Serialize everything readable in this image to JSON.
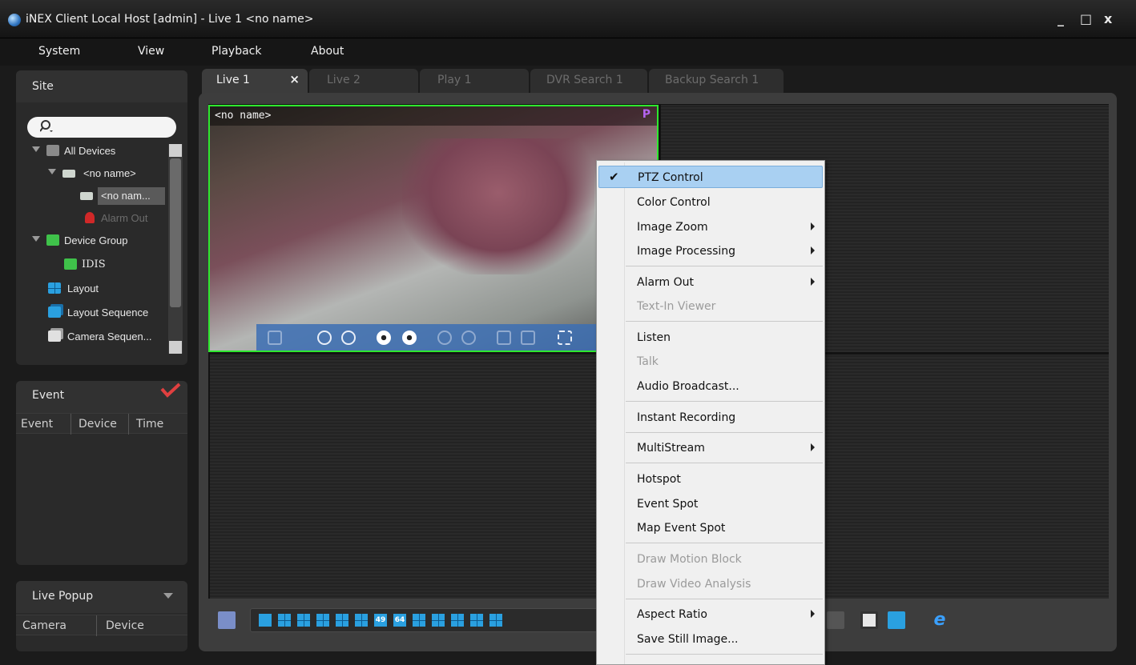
{
  "window": {
    "title": "iNEX Client Local Host [admin] - Live 1  <no name>",
    "controls": [
      "_",
      "□",
      "x"
    ]
  },
  "menubar": [
    "System",
    "View",
    "Playback",
    "About"
  ],
  "site_panel": {
    "title": "Site",
    "tree": [
      {
        "label": "All Devices",
        "icon": "devices-icon"
      },
      {
        "label": "<no name>",
        "icon": "dvr-icon"
      },
      {
        "label": "<no nam...",
        "icon": "camera-icon"
      },
      {
        "label": "Alarm Out",
        "icon": "alarm-icon"
      },
      {
        "label": "Device Group",
        "icon": "group-icon"
      },
      {
        "label": "IDIS",
        "icon": "group-item-icon"
      },
      {
        "label": "Layout",
        "icon": "layout-icon"
      },
      {
        "label": "Layout Sequence",
        "icon": "layout-sequence-icon"
      },
      {
        "label": "Camera Sequen...",
        "icon": "camera-sequence-icon"
      }
    ]
  },
  "event_panel": {
    "title": "Event",
    "columns": [
      "Event",
      "Device",
      "Time"
    ]
  },
  "live_popup_panel": {
    "title": "Live Popup",
    "columns": [
      "Camera",
      "Device"
    ]
  },
  "tabs": [
    {
      "label": "Live 1",
      "active": true
    },
    {
      "label": "Live 2",
      "active": false
    },
    {
      "label": "Play 1",
      "active": false
    },
    {
      "label": "DVR Search 1",
      "active": false
    },
    {
      "label": "Backup Search 1",
      "active": false
    }
  ],
  "camera": {
    "name": "<no name>",
    "badge": "P"
  },
  "layout_buttons": [
    "1",
    "4",
    "9",
    "16",
    "25",
    "36",
    "49",
    "64",
    "6",
    "8",
    "10",
    "13",
    "24"
  ],
  "layout_num_labels": {
    "l49": "49",
    "l64": "64"
  },
  "context_menu": {
    "items": [
      {
        "label": "PTZ Control",
        "checked": true,
        "highlighted": true
      },
      {
        "label": "Color Control"
      },
      {
        "label": "Image Zoom",
        "submenu": true
      },
      {
        "label": "Image Processing",
        "submenu": true
      },
      {
        "label": "Alarm Out",
        "submenu": true
      },
      {
        "label": "Text-In Viewer",
        "disabled": true
      },
      {
        "label": "Listen"
      },
      {
        "label": "Talk",
        "disabled": true
      },
      {
        "label": "Audio Broadcast..."
      },
      {
        "label": "Instant Recording"
      },
      {
        "label": "MultiStream",
        "submenu": true
      },
      {
        "label": "Hotspot"
      },
      {
        "label": "Event Spot"
      },
      {
        "label": "Map Event Spot"
      },
      {
        "label": "Draw Motion Block",
        "disabled": true
      },
      {
        "label": "Draw Video Analysis",
        "disabled": true
      },
      {
        "label": "Aspect Ratio",
        "submenu": true
      },
      {
        "label": "Save Still Image..."
      }
    ]
  },
  "colors": {
    "active_border": "#2ee82e",
    "accent_blue": "#2aa0e0",
    "menu_highlight": "#a9d0f2",
    "event_check": "#e04040"
  }
}
